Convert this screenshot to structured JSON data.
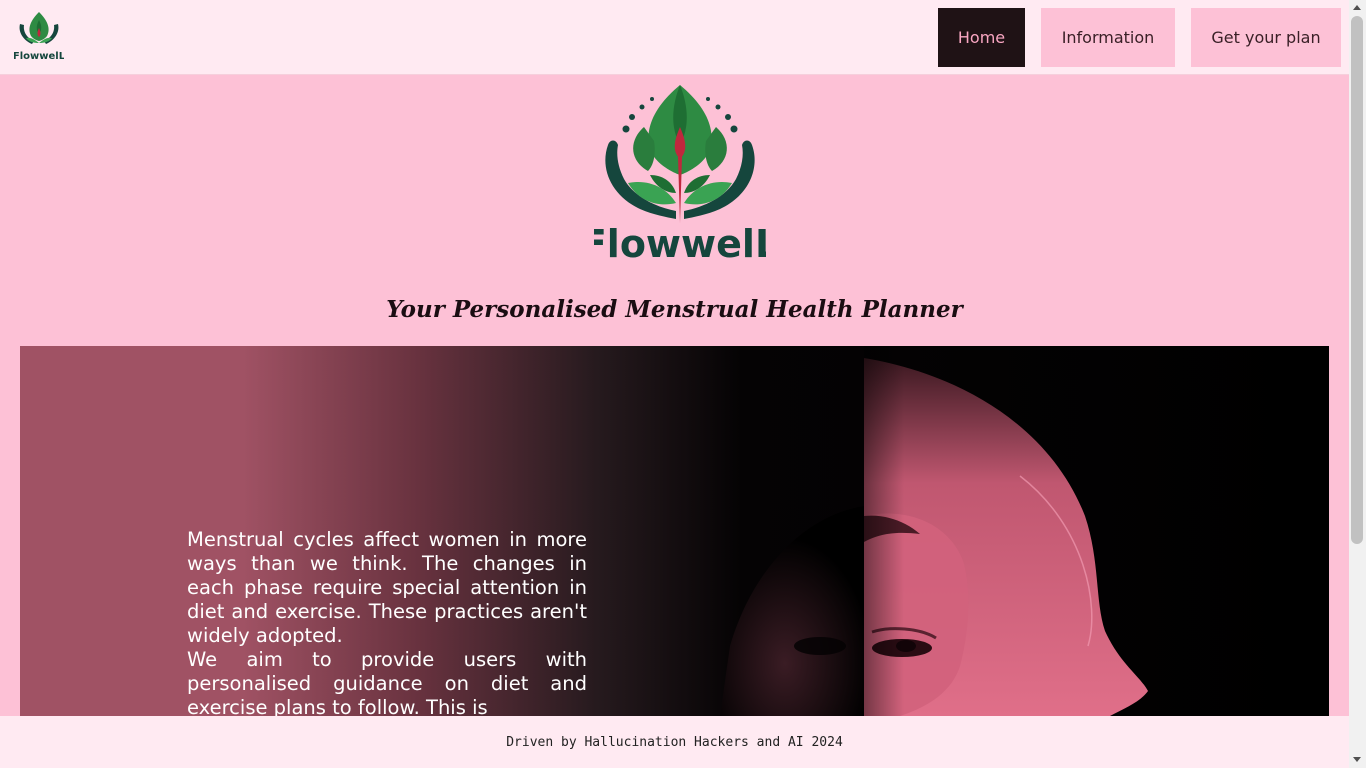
{
  "brand": {
    "name": "FlowwelL",
    "logo_icon": "lotus-hands-drop-icon",
    "colors": {
      "leaf": "#2e8b43",
      "drop": "#c0273d",
      "hands": "#15463d"
    }
  },
  "nav": {
    "items": [
      {
        "label": "Home",
        "active": true
      },
      {
        "label": "Information",
        "active": false
      },
      {
        "label": "Get your plan",
        "active": false
      }
    ]
  },
  "hero": {
    "tagline": "Your Personalised Menstrual Health Planner"
  },
  "banner": {
    "paragraphs": [
      "Menstrual cycles affect women in more ways than we think. The changes in each phase require special attention in diet and exercise. These practices aren't widely adopted.",
      "We aim to provide users with personalised guidance on diet and exercise plans to follow. This is"
    ],
    "art": "woman-face-profile-illustration",
    "colors": {
      "rose": "#a05264",
      "pink": "#dc6b86",
      "black": "#000000"
    }
  },
  "footer": {
    "text": "Driven by Hallucination Hackers and AI  2024"
  },
  "theme": {
    "page_bg": "#fdc1d6",
    "bar_bg": "#ffeaf2",
    "active_bg": "#1f1215",
    "active_text": "#f9a6c2"
  }
}
